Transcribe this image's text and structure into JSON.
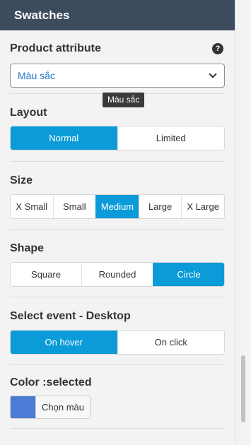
{
  "header": {
    "title": "Swatches"
  },
  "product_attribute": {
    "label": "Product attribute",
    "help_glyph": "?",
    "value": "Màu sắc",
    "tooltip": "Màu sắc"
  },
  "layout": {
    "label": "Layout",
    "options": [
      "Normal",
      "Limited"
    ],
    "selected": "Normal"
  },
  "size": {
    "label": "Size",
    "options": [
      "X Small",
      "Small",
      "Medium",
      "Large",
      "X Large"
    ],
    "selected": "Medium"
  },
  "shape": {
    "label": "Shape",
    "options": [
      "Square",
      "Rounded",
      "Circle"
    ],
    "selected": "Circle"
  },
  "select_event": {
    "label": "Select event - Desktop",
    "options": [
      "On hover",
      "On click"
    ],
    "selected": "On hover"
  },
  "color_selected": {
    "label": "Color :selected",
    "swatch_color": "#4a7bd5",
    "button_label": "Chọn màu"
  },
  "colors": {
    "accent": "#0b9bd8",
    "header_bg": "#3c4b5d"
  }
}
